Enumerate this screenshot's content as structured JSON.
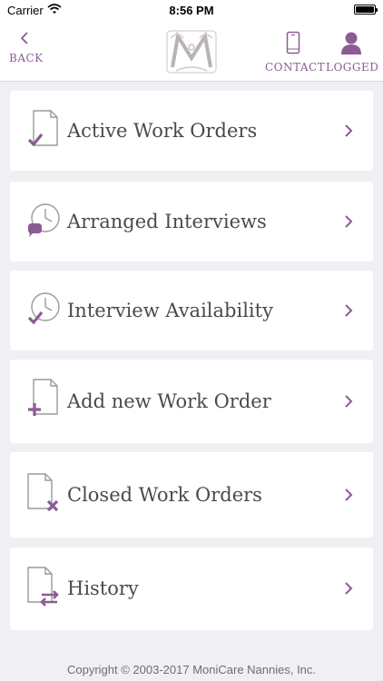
{
  "status_bar": {
    "carrier": "Carrier",
    "time": "8:56 PM",
    "battery_level": 1.0
  },
  "nav": {
    "back_label": "BACK",
    "contact_label": "CONTACT",
    "logged_label": "LOGGED",
    "logo_icon": "monogram-m-logo-icon",
    "accent_color": "#8a5c93"
  },
  "menu": {
    "items": [
      {
        "label": "Active Work Orders",
        "icon": "document-check-icon"
      },
      {
        "label": "Arranged Interviews",
        "icon": "clock-speech-bubble-icon"
      },
      {
        "label": "Interview Availability",
        "icon": "clock-check-icon"
      },
      {
        "label": "Add new Work Order",
        "icon": "document-plus-icon"
      },
      {
        "label": "Closed Work Orders",
        "icon": "document-x-icon"
      },
      {
        "label": "History",
        "icon": "document-swap-icon"
      }
    ]
  },
  "footer": {
    "copyright": "Copyright © 2003-2017 MoniCare Nannies, Inc."
  }
}
